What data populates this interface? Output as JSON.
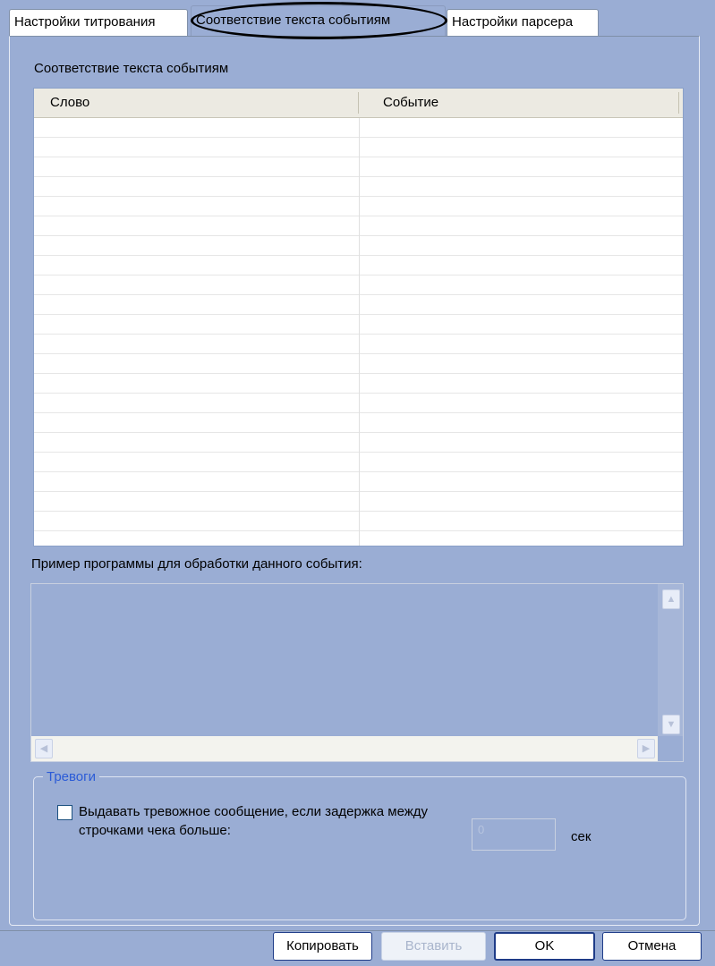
{
  "tabs": [
    {
      "label": "Настройки титрования",
      "active": false
    },
    {
      "label": "Соответствие текста событиям",
      "active": true
    },
    {
      "label": "Настройки парсера",
      "active": false
    }
  ],
  "grid": {
    "title": "Соответствие текста событиям",
    "columns": [
      "Слово",
      "Событие"
    ],
    "rows": []
  },
  "example": {
    "label": "Пример программы для обработки данного события:",
    "value": ""
  },
  "alarms": {
    "group_title": "Тревоги",
    "checkbox_label": "Выдавать тревожное сообщение, если задержка между строчками чека больше:",
    "checked": false,
    "delay_value": "0",
    "unit": "сек"
  },
  "buttons": {
    "copy": "Копировать",
    "paste": "Вставить",
    "ok": "OK",
    "cancel": "Отмена"
  },
  "icons": {
    "scroll_up": "chevron-up-icon",
    "scroll_down": "chevron-down-icon",
    "scroll_left": "chevron-left-icon",
    "scroll_right": "chevron-right-icon"
  }
}
